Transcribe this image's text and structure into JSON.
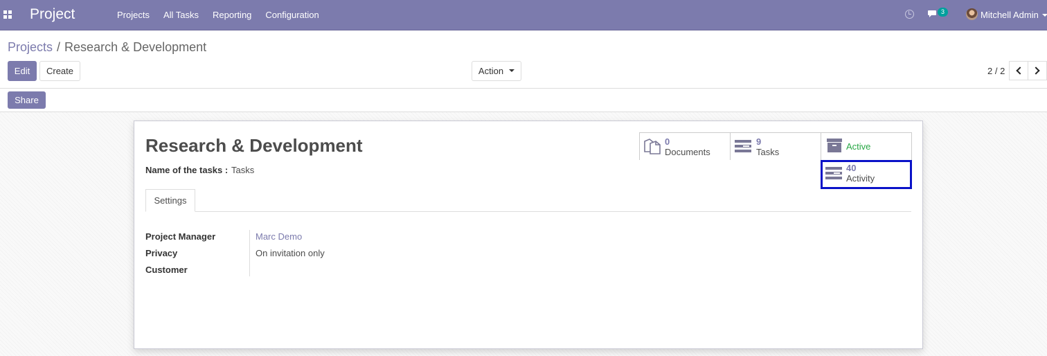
{
  "navbar": {
    "app_name": "Project",
    "menu": [
      "Projects",
      "All Tasks",
      "Reporting",
      "Configuration"
    ],
    "chat_count": "3",
    "user_name": "Mitchell Admin"
  },
  "breadcrumb": {
    "parent": "Projects",
    "separator": "/",
    "current": "Research & Development"
  },
  "buttons": {
    "edit": "Edit",
    "create": "Create",
    "action": "Action",
    "share": "Share"
  },
  "pager": {
    "value": "2 / 2"
  },
  "record": {
    "title": "Research & Development",
    "tasks_label": "Name of the tasks :",
    "tasks_value": "Tasks"
  },
  "smart_buttons": {
    "documents": {
      "count": "0",
      "label": "Documents"
    },
    "tasks": {
      "count": "9",
      "label": "Tasks"
    },
    "active": {
      "label": "Active"
    },
    "activity": {
      "count": "40",
      "label": "Activity"
    }
  },
  "tabs": {
    "settings": "Settings"
  },
  "fields": {
    "project_manager": {
      "label": "Project Manager",
      "value": "Marc Demo"
    },
    "privacy": {
      "label": "Privacy",
      "value": "On invitation only"
    },
    "customer": {
      "label": "Customer",
      "value": ""
    }
  },
  "colors": {
    "brand": "#7c7bad",
    "active": "#28a745",
    "highlight": "#0a12c8",
    "badge": "#00a09d"
  },
  "icons": [
    "apps-grid-icon",
    "clock-icon",
    "chat-icon",
    "documents-icon",
    "tasks-icon",
    "archive-icon",
    "activity-icon",
    "chevron-left-icon",
    "chevron-right-icon"
  ]
}
